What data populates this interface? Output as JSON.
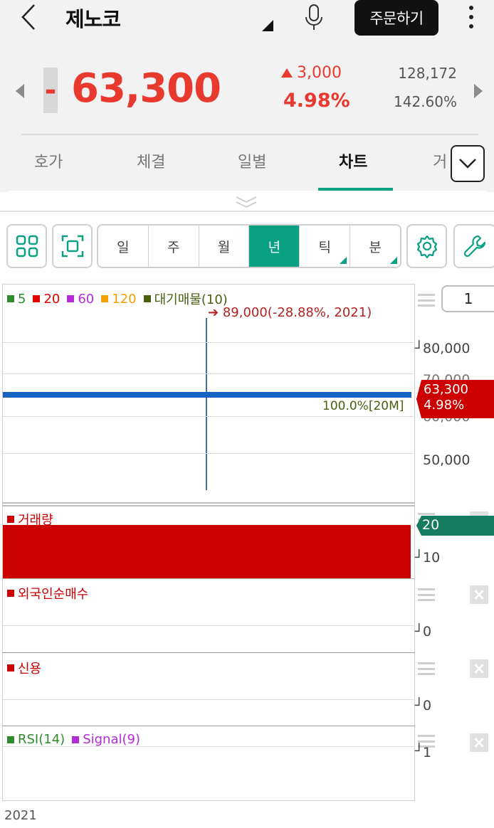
{
  "header": {
    "stock_name": "제노코",
    "order_label": "주문하기",
    "sign": "-",
    "price": "63,300",
    "change": "3,000",
    "change_pct": "4.98%",
    "volume": "128,172",
    "volume_ratio": "142.60%",
    "icons": {
      "back": "chevron-left-icon",
      "mic": "mic-icon",
      "more": "more-vertical-icon"
    }
  },
  "tabs": [
    {
      "label": "호가",
      "active": false
    },
    {
      "label": "체결",
      "active": false
    },
    {
      "label": "일별",
      "active": false
    },
    {
      "label": "차트",
      "active": true
    },
    {
      "label": "거",
      "active": false
    }
  ],
  "toolbar": {
    "periods": [
      {
        "label": "일",
        "active": false,
        "has_sub": false
      },
      {
        "label": "주",
        "active": false,
        "has_sub": false
      },
      {
        "label": "월",
        "active": false,
        "has_sub": false
      },
      {
        "label": "년",
        "active": true,
        "has_sub": false
      },
      {
        "label": "틱",
        "active": false,
        "has_sub": true
      },
      {
        "label": "분",
        "active": false,
        "has_sub": true
      }
    ],
    "icons": [
      "grid-icon",
      "fullscreen-icon",
      "settings-gear-icon",
      "wrench-icon"
    ]
  },
  "chart": {
    "count": "1",
    "price_legend": [
      {
        "label": "5",
        "color": "#2e8b2e"
      },
      {
        "label": "20",
        "color": "#e00000"
      },
      {
        "label": "60",
        "color": "#b52bd9"
      },
      {
        "label": "120",
        "color": "#f0a000"
      },
      {
        "label": "대기매물(10)",
        "color": "#4a5e10"
      }
    ],
    "high_annotation": "89,000(-28.88%, 2021)",
    "y_ticks": [
      "80,000",
      "70,000",
      "60,000",
      "50,000"
    ],
    "current_price_tag": "63,300",
    "current_pct_tag": "4.98%",
    "bar_label": "100.0%[20M]",
    "volume_title": "거래량",
    "volume_tag": "20",
    "volume_ticks": [
      "10"
    ],
    "foreign_title": "외국인순매수",
    "foreign_tick": "0",
    "credit_title": "신용",
    "credit_tick": "0",
    "rsi_title": "RSI(14)",
    "signal_title": "Signal(9)",
    "rsi_tick": "1",
    "x_label": "2021",
    "colors": {
      "accent": "#0aa084",
      "up": "#e8392f",
      "volume_bar": "#cc0000",
      "price_line": "#1565c0",
      "tag_red": "#cc0000",
      "tag_green": "#167a5e"
    }
  }
}
